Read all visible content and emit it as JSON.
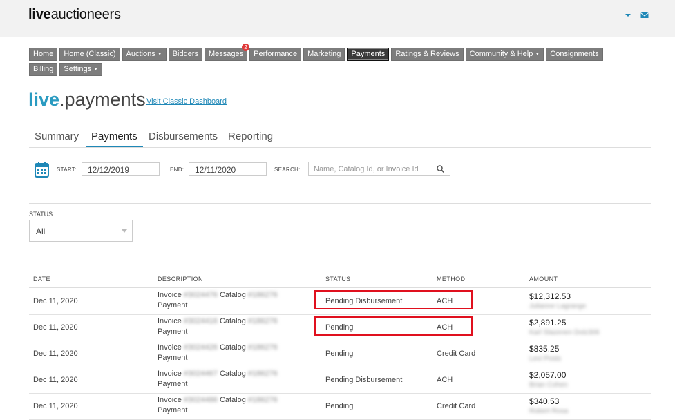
{
  "header": {
    "logo_bold": "live",
    "logo_rest": "auctioneers"
  },
  "nav": [
    {
      "label": "Home"
    },
    {
      "label": "Home (Classic)"
    },
    {
      "label": "Auctions",
      "dropdown": true
    },
    {
      "label": "Bidders"
    },
    {
      "label": "Messages",
      "badge": "2"
    },
    {
      "label": "Performance"
    },
    {
      "label": "Marketing"
    },
    {
      "label": "Payments",
      "active": true
    },
    {
      "label": "Ratings & Reviews"
    },
    {
      "label": "Community & Help",
      "dropdown": true
    },
    {
      "label": "Consignments"
    },
    {
      "label": "Billing"
    },
    {
      "label": "Settings",
      "dropdown": true
    }
  ],
  "page": {
    "title_live": "live",
    "title_rest": ".payments",
    "classic_link": "Visit Classic Dashboard"
  },
  "tabs": [
    {
      "label": "Summary"
    },
    {
      "label": "Payments",
      "active": true
    },
    {
      "label": "Disbursements"
    },
    {
      "label": "Reporting"
    }
  ],
  "filters": {
    "start_label": "START:",
    "start_value": "12/12/2019",
    "end_label": "END:",
    "end_value": "12/11/2020",
    "search_label": "SEARCH:",
    "search_placeholder": "Name, Catalog Id, or Invoice Id",
    "status_label": "STATUS",
    "status_value": "All"
  },
  "table": {
    "columns": [
      "DATE",
      "DESCRIPTION",
      "STATUS",
      "METHOD",
      "AMOUNT"
    ],
    "rows": [
      {
        "date": "Dec 11, 2020",
        "invoice_word": "Invoice",
        "invoice_id": "#3024476",
        "catalog_word": "Catalog",
        "catalog_id": "#186276",
        "line2": "Payment",
        "status": "Pending Disbursement",
        "method": "ACH",
        "amount": "$12,312.53",
        "buyer": "Julianne Lagrange",
        "highlight": true
      },
      {
        "date": "Dec 11, 2020",
        "invoice_word": "Invoice",
        "invoice_id": "#3024416",
        "catalog_word": "Catalog",
        "catalog_id": "#186276",
        "line2": "Payment",
        "status": "Pending",
        "method": "ACH",
        "amount": "$2,891.25",
        "buyer": "Karl Slazenen Dolz306",
        "highlight": true
      },
      {
        "date": "Dec 11, 2020",
        "invoice_word": "Invoice",
        "invoice_id": "#3024426",
        "catalog_word": "Catalog",
        "catalog_id": "#186276",
        "line2": "Payment",
        "status": "Pending",
        "method": "Credit Card",
        "amount": "$835.25",
        "buyer": "Levi Posts",
        "highlight": false
      },
      {
        "date": "Dec 11, 2020",
        "invoice_word": "Invoice",
        "invoice_id": "#3024467",
        "catalog_word": "Catalog",
        "catalog_id": "#186276",
        "line2": "Payment",
        "status": "Pending Disbursement",
        "method": "ACH",
        "amount": "$2,057.00",
        "buyer": "Brian Cohen",
        "highlight": false
      },
      {
        "date": "Dec 11, 2020",
        "invoice_word": "Invoice",
        "invoice_id": "#3024486",
        "catalog_word": "Catalog",
        "catalog_id": "#186276",
        "line2": "Payment",
        "status": "Pending",
        "method": "Credit Card",
        "amount": "$340.53",
        "buyer": "Robert Rosa",
        "highlight": false
      }
    ]
  },
  "colors": {
    "accent": "#1f88b7",
    "highlight_border": "#e0101e",
    "nav_bg": "#7d7d7d",
    "nav_active_bg": "#3a3a3a"
  }
}
